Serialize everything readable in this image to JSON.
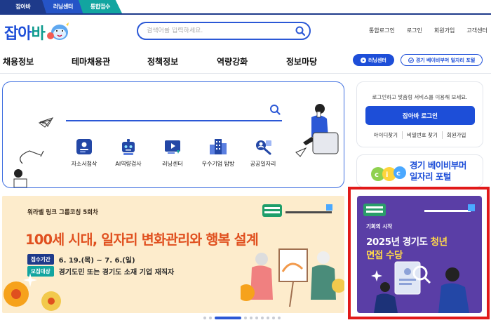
{
  "site_tabs": [
    {
      "label": "잡아바"
    },
    {
      "label": "러닝센터"
    },
    {
      "label": "통합접수"
    }
  ],
  "logo": {
    "text_a": "잡아",
    "text_b": "바"
  },
  "search": {
    "placeholder": "검색어를 입력하세요."
  },
  "util_links": [
    "통합로그인",
    "로그인",
    "회원가입",
    "고객센터"
  ],
  "gnb": [
    "채용정보",
    "테마채용관",
    "정책정보",
    "역량강화",
    "정보마당"
  ],
  "header_buttons": {
    "learning": "러닝센터",
    "portal": "경기 베이비부머 일자리 포털"
  },
  "services": [
    {
      "label": "자소서첨삭",
      "icon": "resume-icon"
    },
    {
      "label": "AI역량검사",
      "icon": "ai-robot-icon"
    },
    {
      "label": "러닝센터",
      "icon": "video-learning-icon"
    },
    {
      "label": "우수기업 탐방",
      "icon": "company-building-icon"
    },
    {
      "label": "공공일자리",
      "icon": "public-job-search-icon"
    }
  ],
  "login": {
    "message": "로그인하고 맞춤형 서비스를 이용해 보세요.",
    "button": "잡아바 로그인",
    "links": [
      "아이디찾기",
      "비밀번호 찾기",
      "회원가입"
    ]
  },
  "portal_card": {
    "line1": "경기 베이비부머",
    "line2": "일자리 포털"
  },
  "banner": {
    "subtitle": "워라벨 링크 그룹코칭 5회차",
    "title": "100세 시대, 일자리 변화관리와 행복 설계",
    "period_tag": "접수기간",
    "period": "6. 19.(목) ~ 7. 6.(일)",
    "target_tag": "모집대상",
    "target": "경기도민 또는 경기도 소재 기업 재직자"
  },
  "side_ad": {
    "subtitle": "기회의 시작",
    "title_a": "2025년 경기도 ",
    "title_b": "청년",
    "title2": "면접 수당"
  },
  "pagination": {
    "total": 10,
    "active": 2
  },
  "colors": {
    "primary": "#1d4ed8",
    "teal": "#12a5a0",
    "banner_bg": "#fdeccc",
    "banner_title": "#e0501f",
    "ad_bg": "#5a3ea6",
    "ad_frame": "#e11919"
  }
}
